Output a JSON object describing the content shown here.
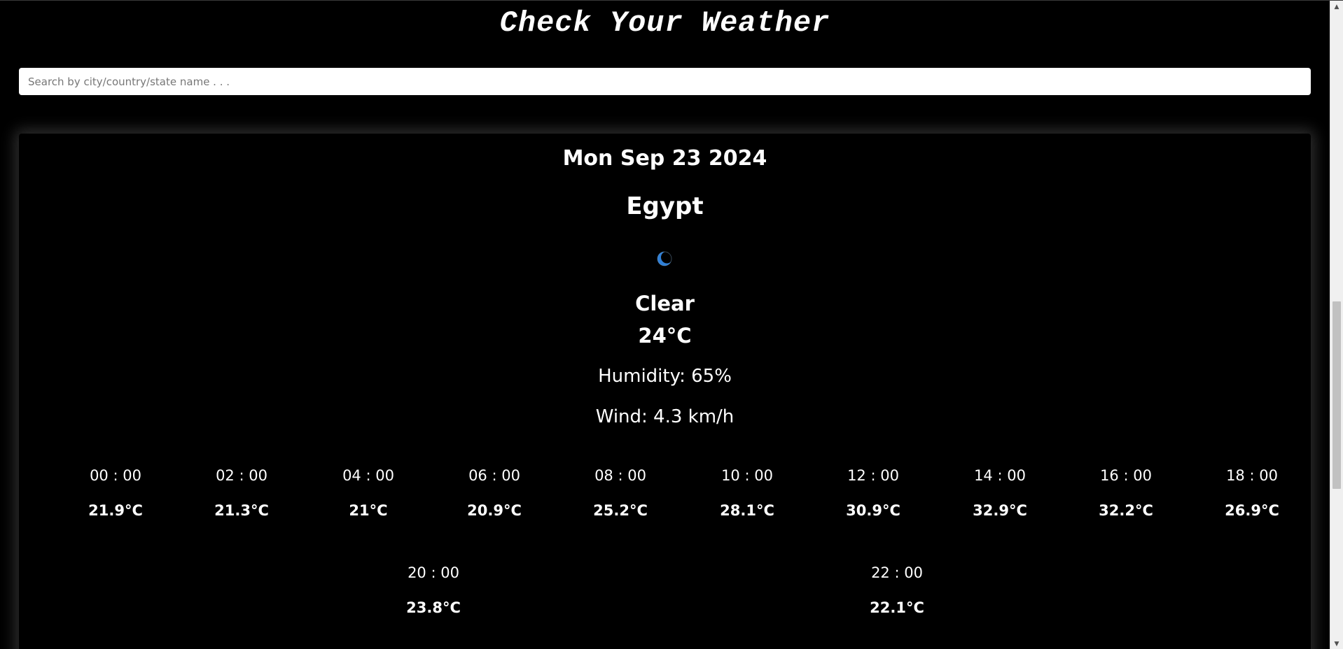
{
  "header": {
    "title": "Check Your Weather"
  },
  "search": {
    "placeholder": "Search by city/country/state name . . .",
    "value": ""
  },
  "current": {
    "date": "Mon Sep 23 2024",
    "location": "Egypt",
    "icon": "crescent-moon-icon",
    "condition": "Clear",
    "temperature": "24°C",
    "humidity": "Humidity: 65%",
    "wind": "Wind: 4.3 km/h"
  },
  "hourly": [
    {
      "time": "00 : 00",
      "temp": "21.9°C"
    },
    {
      "time": "02 : 00",
      "temp": "21.3°C"
    },
    {
      "time": "04 : 00",
      "temp": "21°C"
    },
    {
      "time": "06 : 00",
      "temp": "20.9°C"
    },
    {
      "time": "08 : 00",
      "temp": "25.2°C"
    },
    {
      "time": "10 : 00",
      "temp": "28.1°C"
    },
    {
      "time": "12 : 00",
      "temp": "30.9°C"
    },
    {
      "time": "14 : 00",
      "temp": "32.9°C"
    },
    {
      "time": "16 : 00",
      "temp": "32.2°C"
    },
    {
      "time": "18 : 00",
      "temp": "26.9°C"
    },
    {
      "time": "20 : 00",
      "temp": "23.8°C"
    },
    {
      "time": "22 : 00",
      "temp": "22.1°C"
    }
  ],
  "scrollbar": {
    "position": 0.66,
    "visible_fraction": 0.3
  },
  "colors": {
    "background": "#000000",
    "text": "#ffffff",
    "icon_accent": "#2f7fd6"
  }
}
